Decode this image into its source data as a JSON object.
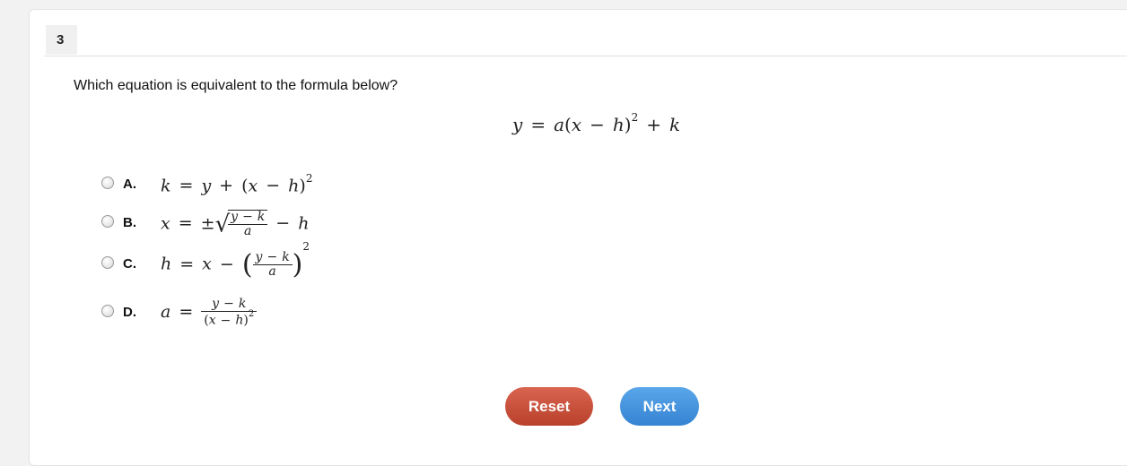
{
  "question": {
    "number": "3",
    "text": "Which equation is equivalent to the formula below?"
  },
  "formula": {
    "lhs": "y",
    "eq": "=",
    "a": "a",
    "open": "(",
    "x": "x",
    "minus": "−",
    "h": "h",
    "close": ")",
    "exp": "2",
    "plus": "+",
    "k": "k"
  },
  "choices": [
    {
      "letter": "A.",
      "label": "k = y + (x − h)^2"
    },
    {
      "letter": "B.",
      "label": "x = ±√((y − k)/a) − h"
    },
    {
      "letter": "C.",
      "label": "h = x − ((y − k)/a)^2"
    },
    {
      "letter": "D.",
      "label": "a = (y − k)/(x − h)^2"
    }
  ],
  "buttons": {
    "reset": "Reset",
    "next": "Next"
  },
  "colors": {
    "reset": "#c9503a",
    "next": "#4a97e0"
  }
}
